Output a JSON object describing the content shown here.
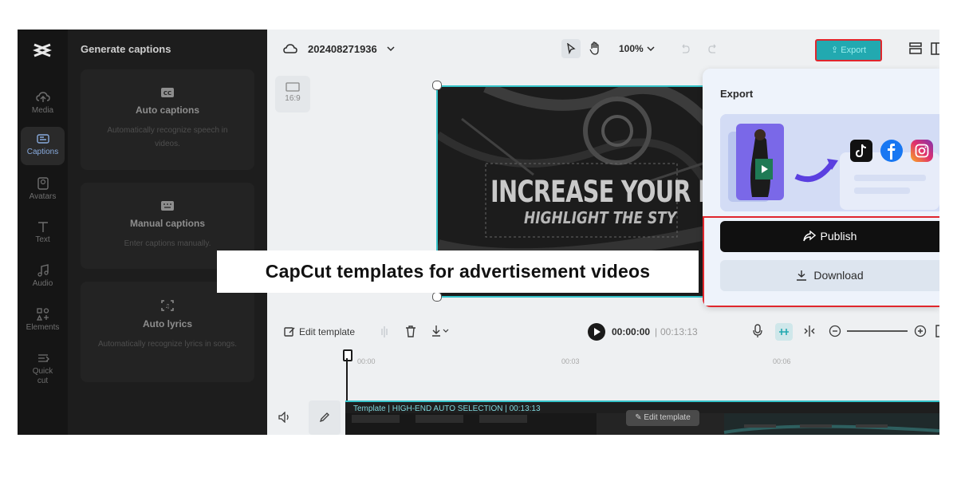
{
  "sidebar": {
    "items": [
      {
        "label": "Media",
        "icon": "cloud-upload-icon"
      },
      {
        "label": "Captions",
        "icon": "captions-icon",
        "active": true
      },
      {
        "label": "Avatars",
        "icon": "avatar-icon"
      },
      {
        "label": "Text",
        "icon": "text-icon"
      },
      {
        "label": "Audio",
        "icon": "music-icon"
      },
      {
        "label": "Elements",
        "icon": "elements-icon"
      },
      {
        "label": "Quick cut",
        "icon": "quick-cut-icon"
      }
    ]
  },
  "panel": {
    "title": "Generate captions",
    "cards": [
      {
        "title": "Auto captions",
        "desc": "Automatically recognize speech in videos.",
        "icon": "cc-icon"
      },
      {
        "title": "Manual captions",
        "desc": "Enter captions manually.",
        "icon": "keyboard-icon"
      },
      {
        "title": "Auto lyrics",
        "desc": "Automatically recognize lyrics in songs.",
        "icon": "lyrics-icon"
      }
    ]
  },
  "header": {
    "project_name": "202408271936",
    "zoom": "100%",
    "export_label": "Export"
  },
  "canvas": {
    "ratio": "16:9",
    "headline": "INCREASE YOUR D",
    "subline": "HIGHLIGHT THE STY"
  },
  "export_popup": {
    "title": "Export",
    "publish_label": "Publish",
    "download_label": "Download"
  },
  "toolbar": {
    "edit_template": "Edit template",
    "current_time": "00:00:00",
    "separator": "|",
    "total_time": "00:13:13"
  },
  "timeline": {
    "ticks": [
      "00:00",
      "00:03",
      "00:06"
    ],
    "track_label": "Template | HIGH-END AUTO SELECTION | 00:13:13",
    "edit_chip": "Edit template"
  },
  "caption": "CapCut templates for advertisement videos",
  "colors": {
    "accent": "#35c3c9",
    "highlight": "#e0262c",
    "export": "#22a9b0"
  }
}
